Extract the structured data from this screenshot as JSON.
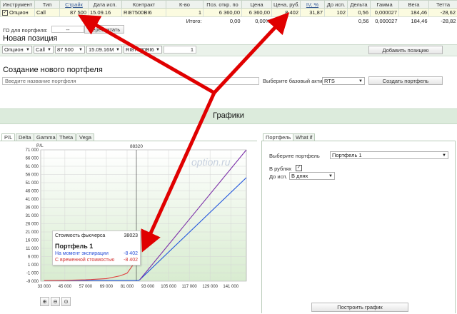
{
  "table": {
    "headers": [
      "Инструмент",
      "Тип",
      "Страйк",
      "Дата исп.",
      "Контракт",
      "К-во",
      "Поз. откр. по",
      "Цена",
      "Цена, руб.",
      "IV, %",
      "До исп.",
      "Дельта",
      "Гамма",
      "Вега",
      "Тетта"
    ],
    "row": [
      "Опцион",
      "Call",
      "87 500",
      "15.09.16",
      "RI87500BI6",
      "1",
      "6 360,00",
      "6 360,00",
      "8 402",
      "31,87",
      "102",
      "0,56",
      "0,000027",
      "184,46",
      "-28,62"
    ],
    "totals": {
      "label": "Итого:",
      "sum": "0,00",
      "pct": "0,00%",
      "delta": "0,56",
      "gamma": "0,000027",
      "vega": "184,46",
      "theta": "-28,82"
    }
  },
  "portfolio_go": {
    "label": "ГО для портфеля:",
    "value": "--",
    "button": "Пересчитать"
  },
  "new_position": {
    "title": "Новая позиция",
    "fields": [
      "Опцион",
      "Call",
      "87 500",
      "15.09.16M",
      "RI87500BI6",
      "1"
    ],
    "add_button": "Добавить позицию"
  },
  "create_portfolio": {
    "title": "Создание нового портфеля",
    "name_placeholder": "Введите название портфеля",
    "asset_label": "Выберите базовый актив",
    "asset_value": "RTS",
    "create_button": "Создать портфель"
  },
  "charts": {
    "title": "Графики",
    "tabs": [
      "P/L",
      "Delta",
      "Gamma",
      "Theta",
      "Vega"
    ],
    "y_axis_label": "P/L",
    "marker_label": "88320",
    "watermark": "option.ru",
    "tooltip": {
      "label1": "Стоимость фьючерса",
      "value1": "38023",
      "portfolio": "Портфель 1",
      "label2": "На момент экспирации",
      "value2": "-8 402",
      "label3": "С временной стоимостью",
      "value3": "-8 402"
    },
    "zoom_icons": [
      "zoom-in-icon",
      "zoom-out-icon",
      "zoom-reset-icon"
    ]
  },
  "chart_data": {
    "type": "line",
    "x_ticks": [
      "33 000",
      "45 000",
      "57 000",
      "69 000",
      "81 000",
      "93 000",
      "105 000",
      "117 000",
      "129 000",
      "141 000"
    ],
    "y_ticks": [
      "71 000",
      "66 000",
      "61 000",
      "56 000",
      "51 000",
      "46 000",
      "41 000",
      "36 000",
      "31 000",
      "26 000",
      "21 000",
      "16 000",
      "11 000",
      "6 000",
      "1 000",
      "-1 000",
      "-9 000"
    ],
    "series": [
      {
        "color": "#2255dd",
        "x": [
          33000,
          87500,
          88320,
          150000
        ],
        "y": [
          -8402,
          -8402,
          -7582,
          54098
        ]
      },
      {
        "color": "#7b2fa8",
        "x": [
          88320,
          150000
        ],
        "y": [
          -7582,
          71000
        ]
      },
      {
        "color": "#e04040",
        "x": [
          33000,
          45000,
          57000,
          69000,
          77000,
          81000,
          85000,
          87500
        ],
        "y": [
          -8350,
          -8200,
          -7700,
          -6500,
          -3800,
          -1200,
          1800,
          4000
        ]
      }
    ]
  },
  "panel": {
    "tabs": [
      "Портфель",
      "What if"
    ],
    "portfolio_label": "Выберите портфель",
    "portfolio_value": "Портфель 1",
    "rub_label": "В рублях",
    "expiry_label": "До исп.",
    "expiry_value": "В днях",
    "build_button": "Построить график"
  },
  "colors": {
    "accent_green": "#dcebdc",
    "arrow_red": "#e00000",
    "grid": "#d5d5d5"
  }
}
